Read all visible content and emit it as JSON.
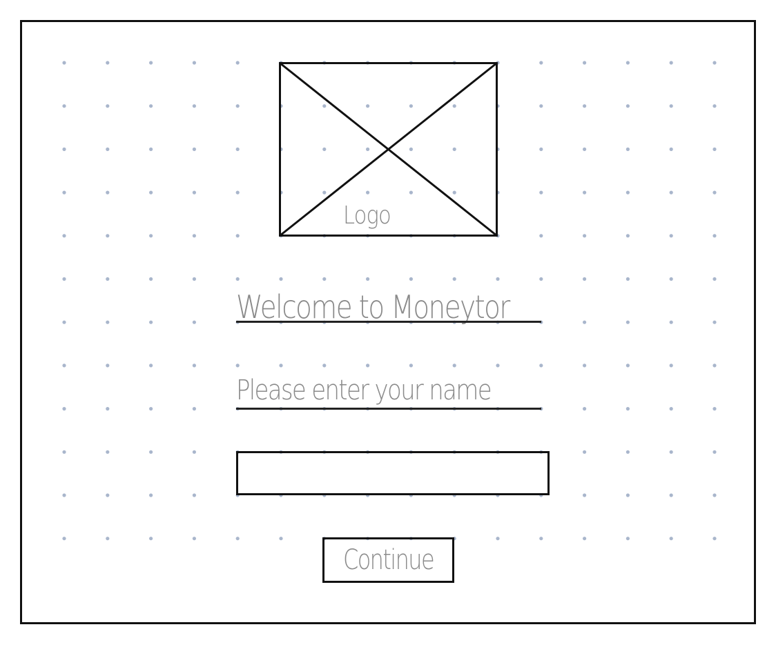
{
  "logo": {
    "label": "Logo"
  },
  "welcome": {
    "title": "Welcome to Moneytor"
  },
  "prompt": {
    "text": "Please enter your name"
  },
  "name_input": {
    "value": "",
    "placeholder": ""
  },
  "continue_button": {
    "label": "Continue"
  },
  "colors": {
    "ink": "#111111",
    "pencil": "#8a8a8a",
    "grid_dot": "#a9b6cc",
    "background": "#ffffff"
  }
}
